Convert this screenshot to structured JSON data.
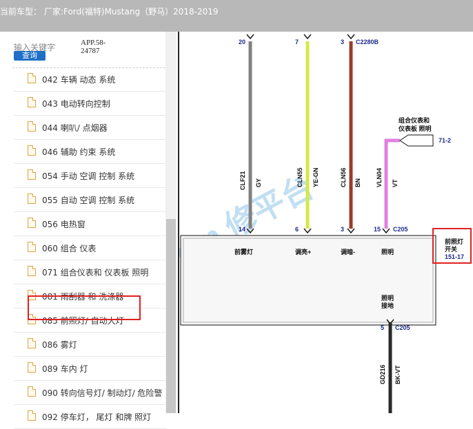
{
  "header": {
    "prefix": "当前车型：",
    "model": "厂家:Ford(福特)Mustang（野马）2018-2019"
  },
  "search": {
    "label": "输入关键字",
    "value": "APP.58-24787",
    "button": "查询"
  },
  "list": [
    "042 车辆 动态 系统",
    "043 电动转向控制",
    "044 喇叭/ 点烟器",
    "046 辅助 约束 系统",
    "054 手动 空调 控制 系统",
    "055 自动 空调 控制 系统",
    "056 电热窗",
    "060 组合 仪表",
    "071 组合仪表和 仪表板 照明",
    "081 雨刮器 和 洗涤器",
    "085 前照灯/ 自动大灯",
    "086 雾灯",
    "089 车内 灯",
    "090 转向信号灯/ 制动灯/ 危险警",
    "092 停车灯， 尾灯 和牌 照灯"
  ],
  "diagram": {
    "top_pins": [
      "20",
      "7",
      "3"
    ],
    "top_connector": "C2280B",
    "wires": [
      {
        "circuit": "CLF21",
        "color": "GY"
      },
      {
        "circuit": "CLN55",
        "color": "YE-GN"
      },
      {
        "circuit": "CLN56",
        "color": "BN"
      },
      {
        "circuit": "VLN04",
        "color": "VT"
      }
    ],
    "bottom_pins": [
      "14",
      "6",
      "3",
      "15"
    ],
    "bottom_connector": "C205",
    "ref_label_line1": "组合仪表和",
    "ref_label_line2": "仪表板 照明",
    "ref_page": "71-2",
    "functions": [
      "前雾灯",
      "调亮+",
      "调暗-",
      "照明"
    ],
    "ground_label_line1": "照明",
    "ground_label_line2": "接地",
    "switch_title_line1": "前照灯",
    "switch_title_line2": "开关",
    "switch_page": "151-17",
    "ground_pin": "5",
    "ground_connector": "C205",
    "ground_wire": {
      "circuit": "GD216",
      "color": "BK-VT"
    },
    "watermark": "om 修平台"
  }
}
